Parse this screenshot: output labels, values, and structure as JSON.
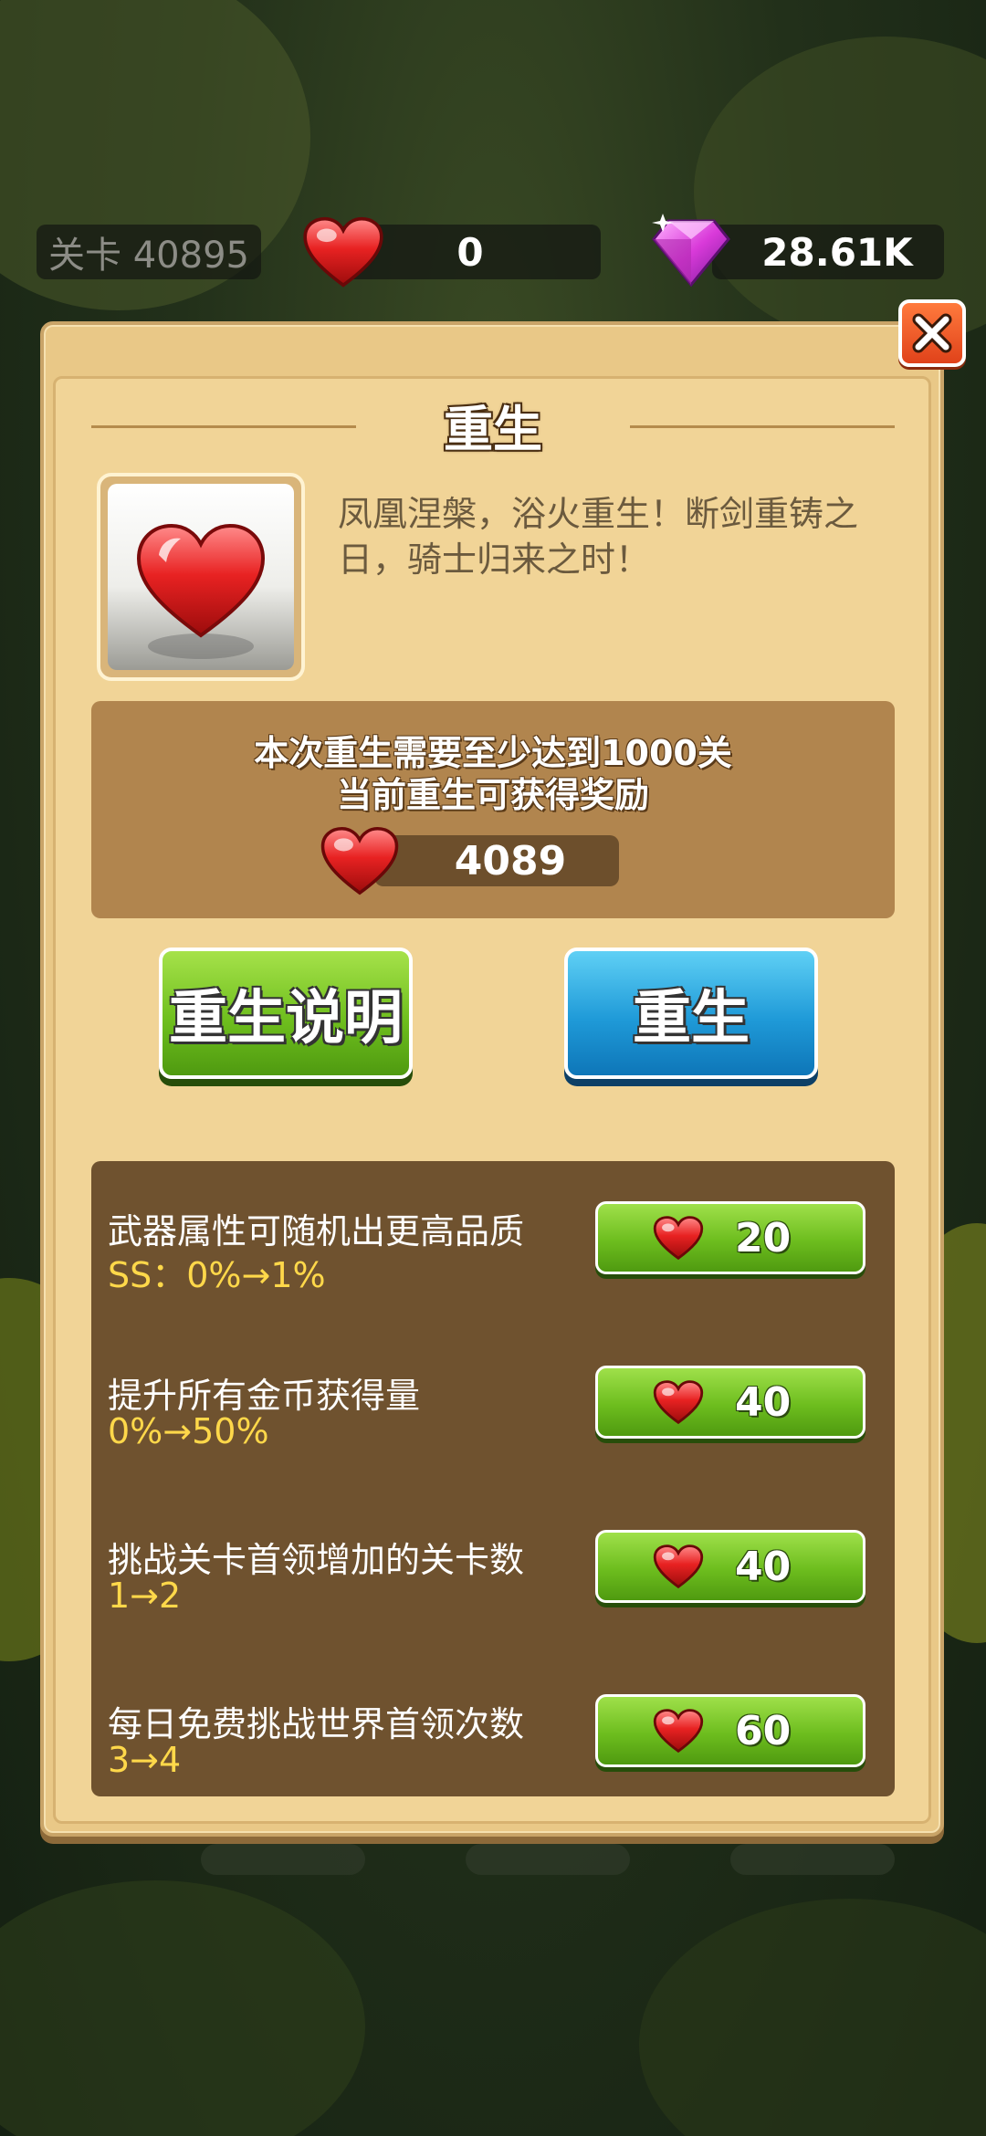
{
  "hud": {
    "level_label": "关卡 40895",
    "hearts": "0",
    "gems": "28.61K"
  },
  "dialog": {
    "title": "重生",
    "description": "凤凰涅槃，浴火重生！断剑重铸之日，骑士归来之时！",
    "requirement": "本次重生需要至少达到1000关",
    "reward_label": "当前重生可获得奖励",
    "reward_value": "4089",
    "explain_button": "重生说明",
    "rebirth_button": "重生"
  },
  "upgrades": [
    {
      "name": "武器属性可随机出更高品质",
      "value": "SS：0%→1%",
      "cost": "20"
    },
    {
      "name": "提升所有金币获得量",
      "value": "0%→50%",
      "cost": "40"
    },
    {
      "name": "挑战关卡首领增加的关卡数",
      "value": "1→2",
      "cost": "40"
    },
    {
      "name": "每日免费挑战世界首领次数",
      "value": "3→4",
      "cost": "60"
    }
  ],
  "icons": {
    "heart": "heart-icon",
    "gem": "gem-icon",
    "close": "close-icon"
  },
  "colors": {
    "panel": "#e9c887",
    "green_button": "#6fbf1e",
    "blue_button": "#1f9ad8",
    "upgrade_value": "#ffd84a"
  }
}
